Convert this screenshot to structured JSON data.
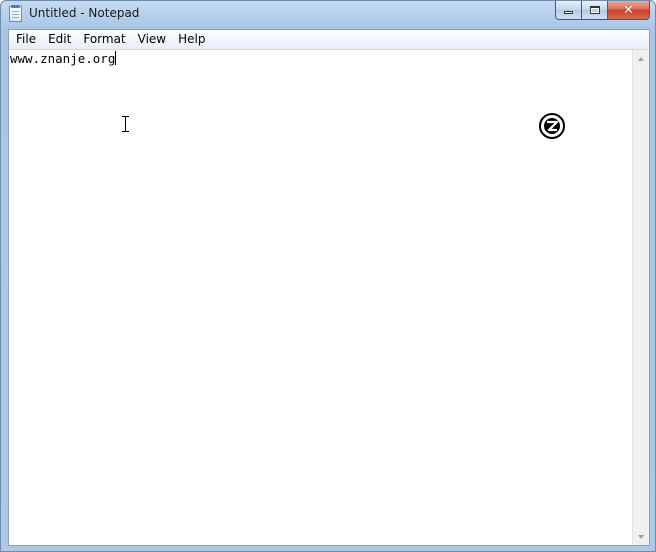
{
  "window": {
    "title": "Untitled - Notepad",
    "icon": "notepad-icon"
  },
  "caption_buttons": {
    "minimize_icon": "minimize-icon",
    "maximize_icon": "maximize-icon",
    "close_icon": "close-icon",
    "close_glyph": "✕"
  },
  "menu": {
    "items": [
      {
        "label": "File"
      },
      {
        "label": "Edit"
      },
      {
        "label": "Format"
      },
      {
        "label": "View"
      },
      {
        "label": "Help"
      }
    ]
  },
  "editor": {
    "content": "www.znanje.org"
  },
  "colors": {
    "frame": "#aec9e6",
    "close_button": "#c7432a",
    "editor_background": "#ffffff"
  }
}
